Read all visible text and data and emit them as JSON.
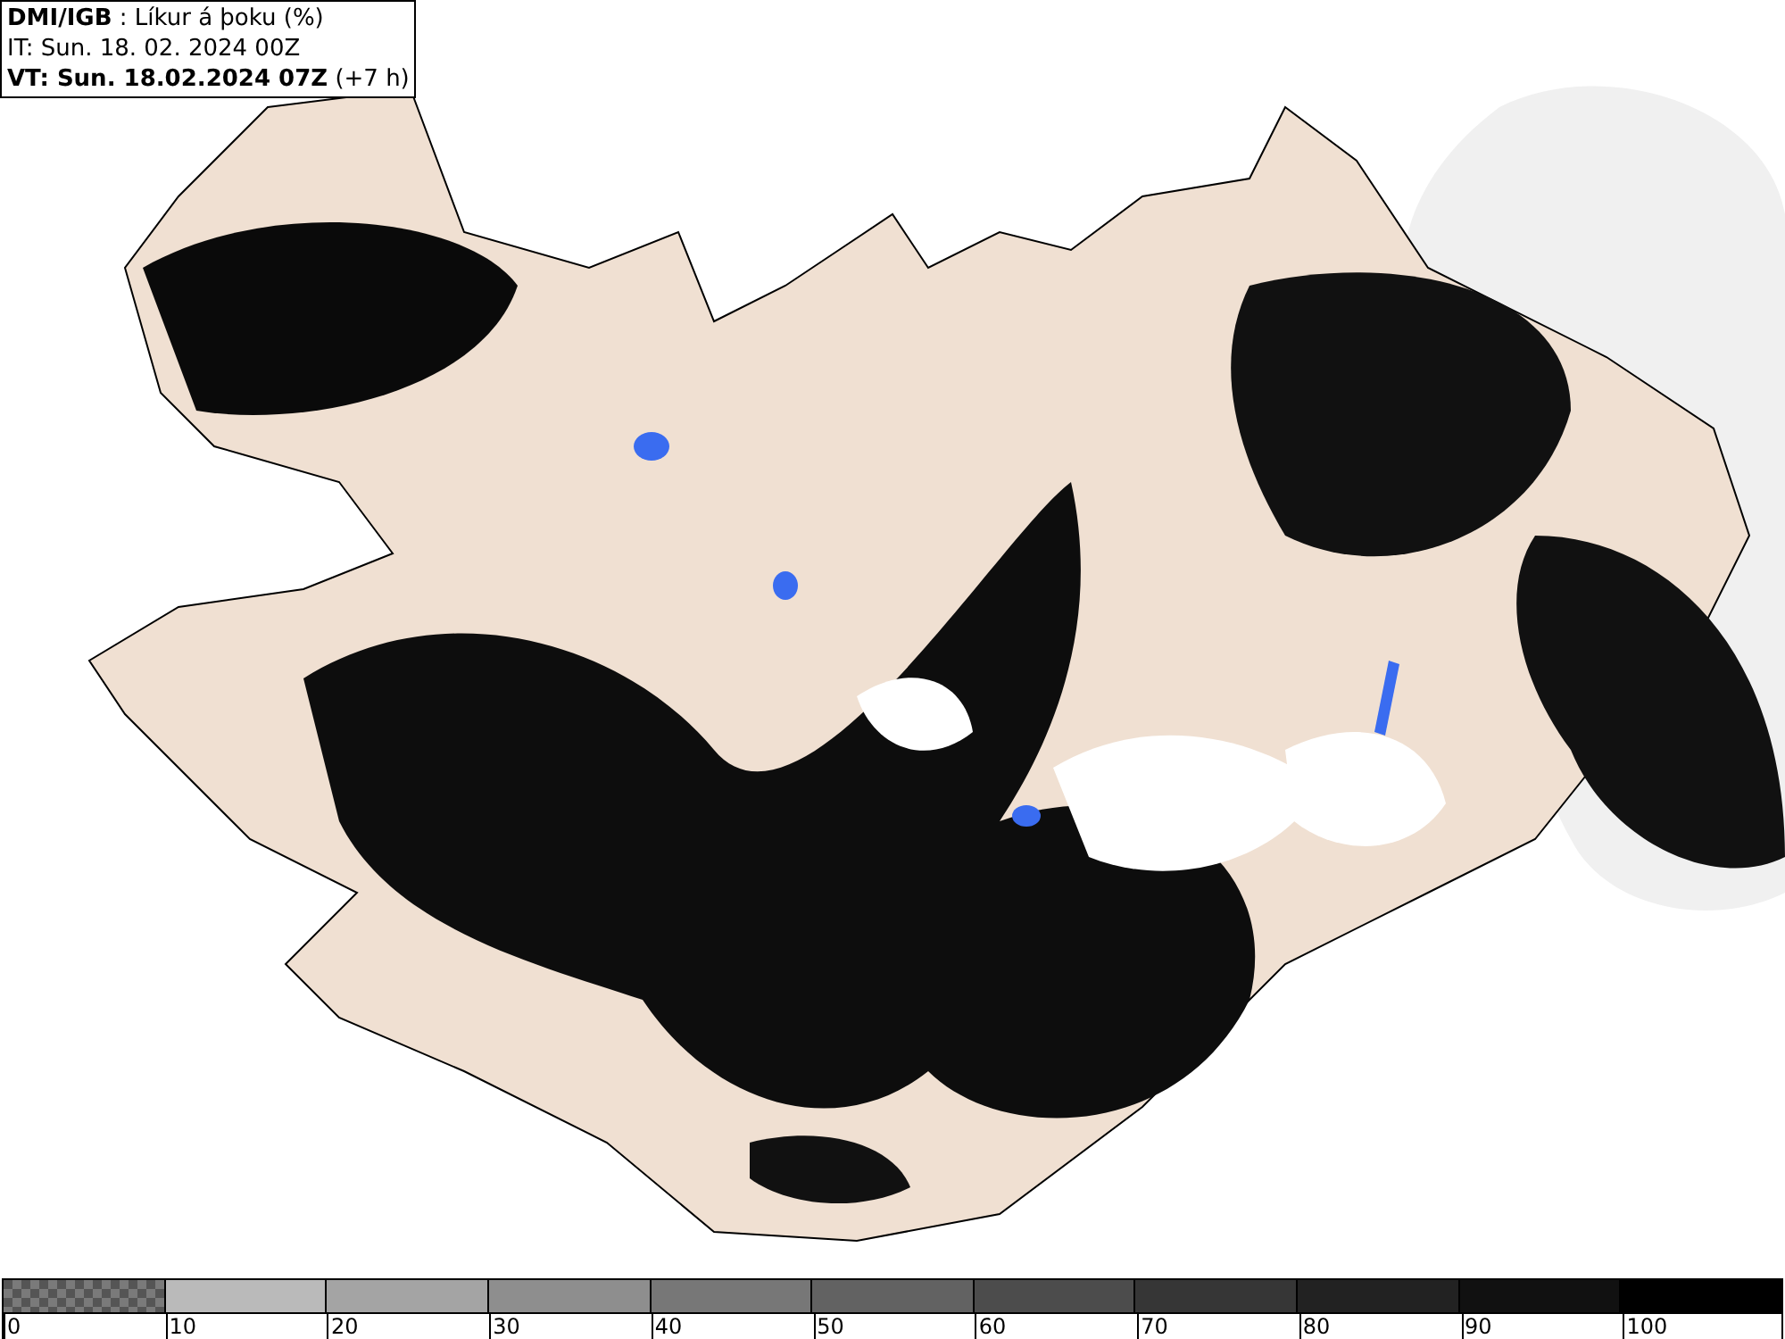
{
  "header": {
    "lines": [
      "**DMI/IGB** : Líkur á þoku (%)",
      "IT: Sun. 18. 02. 2024 00Z",
      "**VT: Sun. 18.02.2024 07Z** (+7 h)"
    ]
  },
  "legend": {
    "segments": [
      {
        "kind": "checker",
        "color": "#7a7a7a"
      },
      {
        "kind": "solid",
        "color": "#bababa"
      },
      {
        "kind": "solid",
        "color": "#a4a4a4"
      },
      {
        "kind": "solid",
        "color": "#8e8e8e"
      },
      {
        "kind": "solid",
        "color": "#777777"
      },
      {
        "kind": "solid",
        "color": "#626262"
      },
      {
        "kind": "solid",
        "color": "#4c4c4c"
      },
      {
        "kind": "solid",
        "color": "#363636"
      },
      {
        "kind": "solid",
        "color": "#222222"
      },
      {
        "kind": "solid",
        "color": "#111111"
      },
      {
        "kind": "solid",
        "color": "#000000"
      }
    ],
    "ticks": [
      "0",
      "10",
      "20",
      "30",
      "40",
      "50",
      "60",
      "70",
      "80",
      "90",
      "100"
    ]
  }
}
